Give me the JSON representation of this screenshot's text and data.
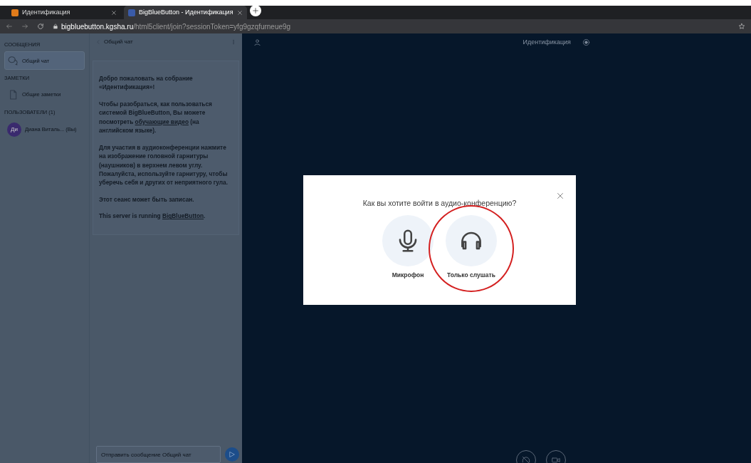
{
  "browser": {
    "tabs": [
      {
        "title": "Идентификация",
        "selected": false
      },
      {
        "title": "BigBlueButton - Идентификация",
        "selected": true
      }
    ],
    "url": {
      "host": "bigbluebutton.kgsha.ru",
      "path": "/html5client/join?sessionToken=yfg9gzqfurneue9g"
    }
  },
  "sidebar": {
    "sections": [
      {
        "heading": "СООБЩЕНИЯ",
        "items": [
          {
            "label": "Общий чат",
            "kind": "chat",
            "selected": true
          }
        ]
      },
      {
        "heading": "ЗАМЕТКИ",
        "items": [
          {
            "label": "Общие заметки",
            "kind": "notes",
            "selected": false
          }
        ]
      },
      {
        "heading": "ПОЛЬЗОВАТЕЛИ (1)",
        "items": [
          {
            "label": "Диана Виталь... (Вы)",
            "kind": "user",
            "avatar": "Ди",
            "selected": false
          }
        ]
      }
    ]
  },
  "chat": {
    "title": "Общий чат",
    "paragraphs": [
      [
        {
          "kind": "text",
          "text": "Добро пожаловать на собрание «**Идентификация**»!"
        }
      ],
      [
        {
          "kind": "text",
          "text": "Чтобы разобраться, как пользоваться системой BigBlueButton, Вы можете посмотреть "
        },
        {
          "kind": "link",
          "text": "обучающие видео"
        },
        {
          "kind": "text",
          "text": " (на английском языке)."
        }
      ],
      [
        {
          "kind": "text",
          "text": "Для участия в аудиоконференции нажмите на изображение головной гарнитуры (наушников) в верхнем левом углу. **Пожалуйста, используйте гарнитуру, чтобы уберечь себя и других от неприятного гула.**"
        }
      ],
      [
        {
          "kind": "text",
          "text": "Этот сеанс может быть записан."
        }
      ],
      [
        {
          "kind": "text",
          "text": "This server is running "
        },
        {
          "kind": "link",
          "text": "BigBlueButton"
        },
        {
          "kind": "text",
          "text": "."
        }
      ]
    ],
    "placeholder": "Отправить сообщение Общий чат"
  },
  "main": {
    "meeting_title": "Идентификация"
  },
  "modal": {
    "question": "Как вы хотите войти в аудио-конференцию?",
    "options": [
      {
        "kind": "microphone",
        "label": "Микрофон",
        "highlighted": false
      },
      {
        "kind": "listen",
        "label": "Только слушать",
        "highlighted": true
      }
    ]
  }
}
